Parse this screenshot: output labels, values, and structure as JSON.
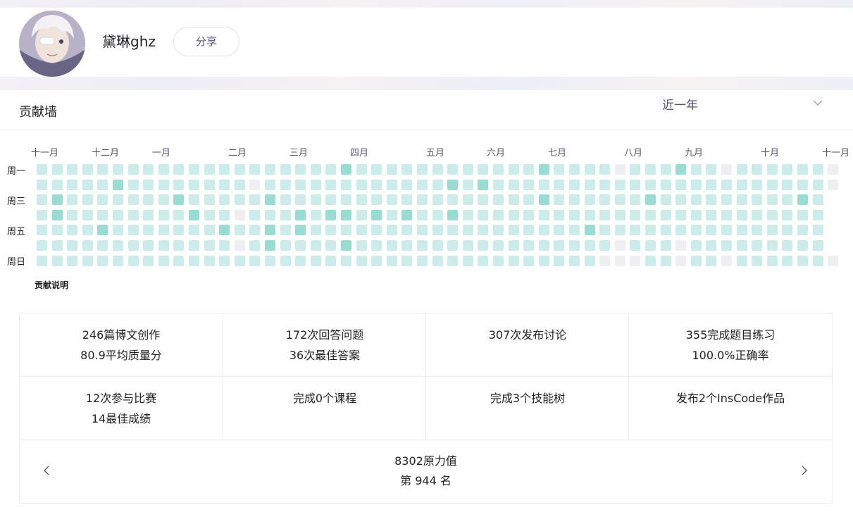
{
  "profile": {
    "username": "黛琳ghz",
    "share_label": "分享"
  },
  "contribution": {
    "title": "贡献墙",
    "range": "近一年",
    "months": [
      "十一月",
      "十二月",
      "一月",
      "二月",
      "三月",
      "四月",
      "五月",
      "六月",
      "七月",
      "八月",
      "九月",
      "十月",
      "十一月"
    ],
    "weekdays": [
      "周一",
      "周三",
      "周五",
      "周日"
    ],
    "legend_link": "贡献说明",
    "weeks": 53,
    "highlighted_days": [
      [
        0,
        20
      ],
      [
        0,
        33
      ],
      [
        0,
        42
      ],
      [
        1,
        5
      ],
      [
        1,
        27
      ],
      [
        1,
        29
      ],
      [
        2,
        1
      ],
      [
        2,
        9
      ],
      [
        2,
        15
      ],
      [
        2,
        33
      ],
      [
        2,
        40
      ],
      [
        2,
        50
      ],
      [
        3,
        1
      ],
      [
        3,
        10
      ],
      [
        3,
        17
      ],
      [
        3,
        19
      ],
      [
        3,
        20
      ],
      [
        3,
        22
      ],
      [
        3,
        24
      ],
      [
        3,
        27
      ],
      [
        4,
        4
      ],
      [
        4,
        12
      ],
      [
        4,
        15
      ],
      [
        4,
        17
      ],
      [
        4,
        36
      ],
      [
        5,
        15
      ],
      [
        5,
        20
      ]
    ],
    "empty_days": [
      [
        0,
        38
      ],
      [
        0,
        45
      ],
      [
        0,
        52
      ],
      [
        1,
        14
      ],
      [
        1,
        52
      ],
      [
        3,
        13
      ],
      [
        5,
        13
      ],
      [
        5,
        38
      ],
      [
        5,
        42
      ],
      [
        6,
        37
      ],
      [
        6,
        38
      ],
      [
        6,
        39
      ],
      [
        6,
        42
      ],
      [
        6,
        45
      ],
      [
        6,
        52
      ]
    ],
    "future_days": [
      [
        2,
        52
      ],
      [
        3,
        52
      ],
      [
        4,
        52
      ],
      [
        5,
        52
      ]
    ],
    "colors": {
      "level_1": "#ccece9",
      "level_2": "#9adcd2",
      "empty": "#efeff1"
    }
  },
  "stats": [
    {
      "line1": "246篇博文创作",
      "line2": "80.9平均质量分"
    },
    {
      "line1": "172次回答问题",
      "line2": "36次最佳答案"
    },
    {
      "line1": "307次发布讨论",
      "line2": ""
    },
    {
      "line1": "355完成题目练习",
      "line2": "100.0%正确率"
    },
    {
      "line1": "12次参与比赛",
      "line2": "14最佳成绩"
    },
    {
      "line1": "完成0个课程",
      "line2": ""
    },
    {
      "line1": "完成3个技能树",
      "line2": ""
    },
    {
      "line1": "发布2个InsCode作品",
      "line2": ""
    }
  ],
  "rank": {
    "power": "8302原力值",
    "position": "第 944 名"
  }
}
